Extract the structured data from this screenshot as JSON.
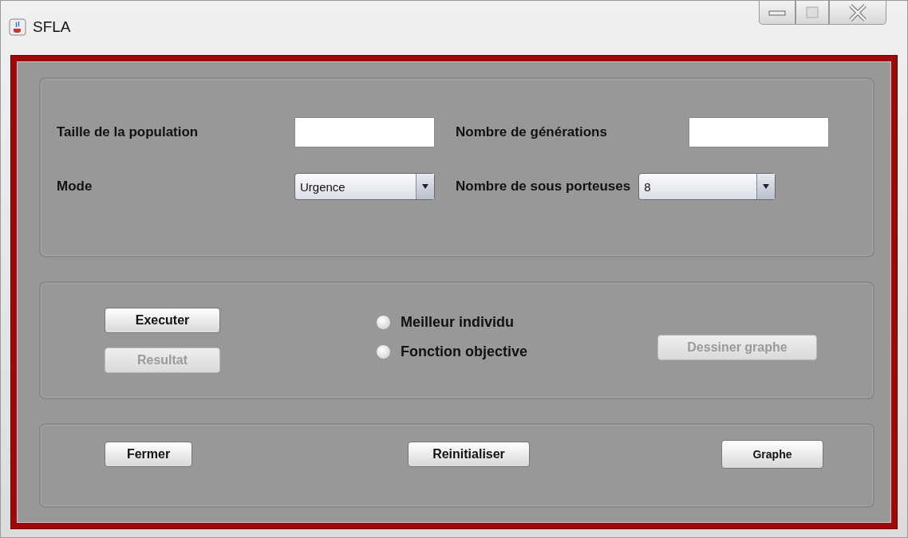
{
  "window": {
    "title": "SFLA"
  },
  "settings": [
    {
      "kind": "text",
      "label": "Taille de la population"
    },
    {
      "kind": "text",
      "label": "Nombre de générations"
    },
    {
      "kind": "combo",
      "label": "Mode",
      "value": "Urgence"
    },
    {
      "kind": "combo",
      "label": "Nombre de sous porteuses",
      "value": "8"
    }
  ],
  "run_panel": {
    "buttons": [
      {
        "label": "Executer",
        "disabled": false
      },
      {
        "label": "Resultat",
        "disabled": true
      }
    ],
    "radios": [
      {
        "label": "Meilleur individu",
        "selected": false
      },
      {
        "label": "Fonction objective",
        "selected": false
      }
    ],
    "draw_button": {
      "label": "Dessiner graphe",
      "disabled": true
    }
  },
  "bottom_buttons": [
    {
      "label": "Fermer",
      "disabled": false
    },
    {
      "label": "Reinitialiser",
      "disabled": false
    },
    {
      "label": "Graphe",
      "disabled": false
    }
  ]
}
